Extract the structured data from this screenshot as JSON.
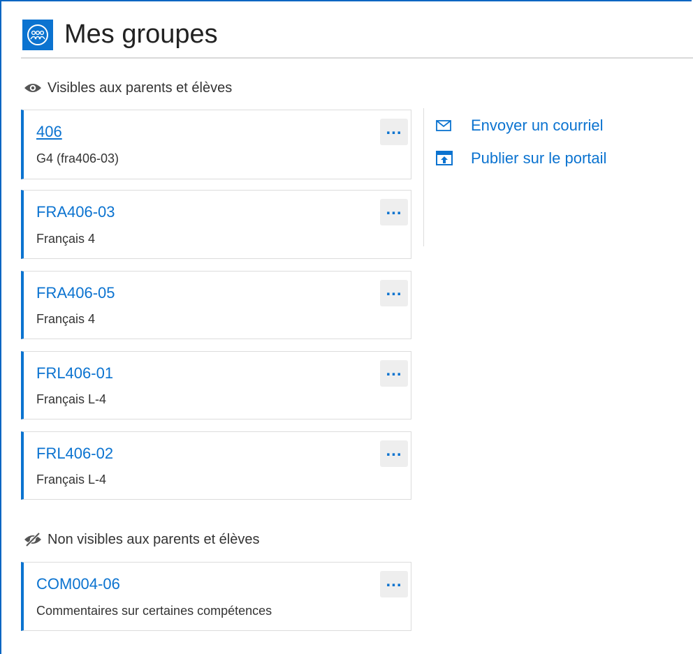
{
  "header": {
    "title": "Mes groupes",
    "icon": "groups-icon"
  },
  "colors": {
    "accent": "#0b73d0",
    "border": "#dcdcdc",
    "button_bg": "#eeeeee"
  },
  "visible_section": {
    "label": "Visibles aux parents et élèves",
    "icon": "eye-icon",
    "groups": [
      {
        "name": "406",
        "desc": "G4 (fra406-03)",
        "more": "..."
      },
      {
        "name": "FRA406-03",
        "desc": "Français 4",
        "more": "..."
      },
      {
        "name": "FRA406-05",
        "desc": "Français 4",
        "more": "..."
      },
      {
        "name": "FRL406-01",
        "desc": "Français L-4",
        "more": "..."
      },
      {
        "name": "FRL406-02",
        "desc": "Français L-4",
        "more": "..."
      }
    ]
  },
  "hidden_section": {
    "label": "Non visibles aux parents et élèves",
    "icon": "eye-slash-icon",
    "groups": [
      {
        "name": "COM004-06",
        "desc": "Commentaires sur certaines compétences",
        "more": "..."
      }
    ]
  },
  "actions": [
    {
      "label": "Envoyer un courriel",
      "icon": "envelope-icon"
    },
    {
      "label": "Publier sur le portail",
      "icon": "publish-icon"
    }
  ]
}
